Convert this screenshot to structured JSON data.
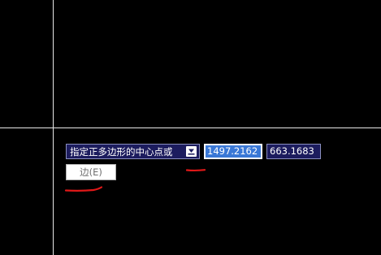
{
  "prompt": {
    "text": "指定正多边形的中心点或",
    "options_icon": "down-arrow-icon"
  },
  "coordinates": {
    "x_value": "1497.2162",
    "y_value": "663.1683"
  },
  "options": [
    {
      "label": "边(E)"
    }
  ],
  "colors": {
    "background": "#000000",
    "crosshair": "#e8e8e8",
    "prompt_bg": "#1c1c5e",
    "selection": "#3a78d6",
    "annotation_mark": "#e01818"
  }
}
